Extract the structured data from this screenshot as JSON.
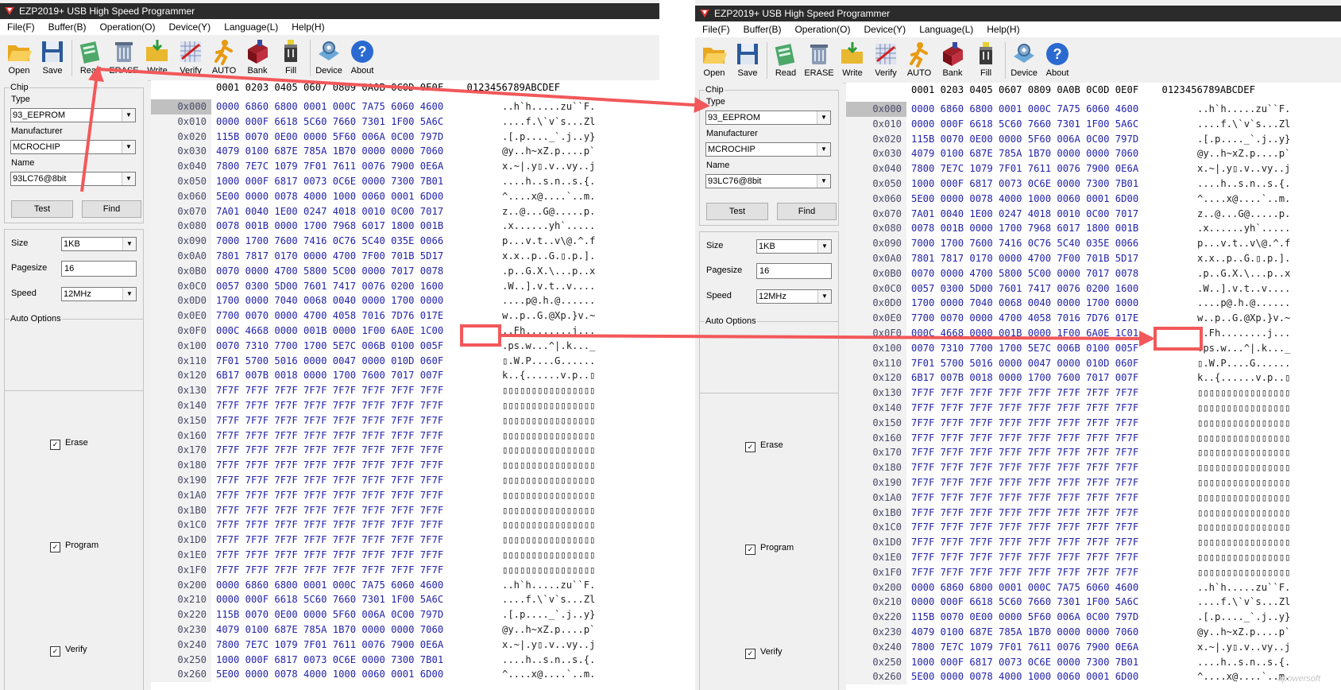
{
  "app_title": "EZP2019+ USB High Speed Programmer",
  "menu": [
    "File(F)",
    "Buffer(B)",
    "Operation(O)",
    "Device(Y)",
    "Language(L)",
    "Help(H)"
  ],
  "toolbar": {
    "open": "Open",
    "save": "Save",
    "read": "Read",
    "erase": "ERASE",
    "write": "Write",
    "verify": "Verify",
    "auto": "AUTO",
    "bank": "Bank",
    "fill": "Fill",
    "device": "Device",
    "about": "About"
  },
  "chip": {
    "group_label": "Chip",
    "type_label": "Type",
    "type_value": "93_EEPROM",
    "manufacturer_label": "Manufacturer",
    "manufacturer_value": "MCROCHIP",
    "name_label": "Name",
    "name_value": "93LC76@8bit",
    "test_button": "Test",
    "find_button": "Find"
  },
  "params": {
    "size_label": "Size",
    "size_value": "1KB",
    "pagesize_label": "Pagesize",
    "pagesize_value": "16",
    "speed_label": "Speed",
    "speed_value": "12MHz"
  },
  "auto_options": {
    "group_label": "Auto Options",
    "erase": "Erase",
    "program": "Program",
    "verify": "Verify"
  },
  "hex_header": "0001 0203 0405 0607 0809 0A0B 0C0D 0E0F    0123456789ABCDEF",
  "hex_rows": [
    [
      "0x000",
      "0000 6860 6800 0001 000C 7A75 6060 4600",
      "..h`h.....zu``F."
    ],
    [
      "0x010",
      "0000 000F 6618 5C60 7660 7301 1F00 5A6C",
      "....f.\\`v`s...Zl"
    ],
    [
      "0x020",
      "115B 0070 0E00 0000 5F60 006A 0C00 797D",
      ".[.p...._`.j..y}"
    ],
    [
      "0x030",
      "4079 0100 687E 785A 1B70 0000 0000 7060",
      "@y..h~xZ.p....p`"
    ],
    [
      "0x040",
      "7800 7E7C 1079 7F01 7611 0076 7900 0E6A",
      "x.~|.y▯.v..vy..j"
    ],
    [
      "0x050",
      "1000 000F 6817 0073 0C6E 0000 7300 7B01",
      "....h..s.n..s.{."
    ],
    [
      "0x060",
      "5E00 0000 0078 4000 1000 0060 0001 6D00",
      "^....x@....`..m."
    ],
    [
      "0x070",
      "7A01 0040 1E00 0247 4018 0010 0C00 7017",
      "z..@...G@.....p."
    ],
    [
      "0x080",
      "0078 001B 0000 1700 7968 6017 1800 001B",
      ".x......yh`....."
    ],
    [
      "0x090",
      "7000 1700 7600 7416 0C76 5C40 035E 0066",
      "p...v.t..v\\@.^.f"
    ],
    [
      "0x0A0",
      "7801 7817 0170 0000 4700 7F00 701B 5D17",
      "x.x..p..G.▯.p.]."
    ],
    [
      "0x0B0",
      "0070 0000 4700 5800 5C00 0000 7017 0078",
      ".p..G.X.\\...p..x"
    ],
    [
      "0x0C0",
      "0057 0300 5D00 7601 7417 0076 0200 1600",
      ".W..].v.t..v...."
    ],
    [
      "0x0D0",
      "1700 0000 7040 0068 0040 0000 1700 0000",
      "....p@.h.@......"
    ],
    [
      "0x0E0",
      "7700 0070 0000 4700 4058 7016 7D76 017E",
      "w..p..G.@Xp.}v.~"
    ],
    [
      "0x0F0",
      "000C 4668 0000 001B 0000 1F00 6A0E 1C00",
      "..Fh........j..."
    ],
    [
      "0x100",
      "0070 7310 7700 1700 5E7C 006B 0100 005F",
      ".ps.w...^|.k..._"
    ],
    [
      "0x110",
      "7F01 5700 5016 0000 0047 0000 010D 060F",
      "▯.W.P....G......"
    ],
    [
      "0x120",
      "6B17 007B 0018 0000 1700 7600 7017 007F",
      "k..{......v.p..▯"
    ],
    [
      "0x130",
      "7F7F 7F7F 7F7F 7F7F 7F7F 7F7F 7F7F 7F7F",
      "▯▯▯▯▯▯▯▯▯▯▯▯▯▯▯▯"
    ],
    [
      "0x140",
      "7F7F 7F7F 7F7F 7F7F 7F7F 7F7F 7F7F 7F7F",
      "▯▯▯▯▯▯▯▯▯▯▯▯▯▯▯▯"
    ],
    [
      "0x150",
      "7F7F 7F7F 7F7F 7F7F 7F7F 7F7F 7F7F 7F7F",
      "▯▯▯▯▯▯▯▯▯▯▯▯▯▯▯▯"
    ],
    [
      "0x160",
      "7F7F 7F7F 7F7F 7F7F 7F7F 7F7F 7F7F 7F7F",
      "▯▯▯▯▯▯▯▯▯▯▯▯▯▯▯▯"
    ],
    [
      "0x170",
      "7F7F 7F7F 7F7F 7F7F 7F7F 7F7F 7F7F 7F7F",
      "▯▯▯▯▯▯▯▯▯▯▯▯▯▯▯▯"
    ],
    [
      "0x180",
      "7F7F 7F7F 7F7F 7F7F 7F7F 7F7F 7F7F 7F7F",
      "▯▯▯▯▯▯▯▯▯▯▯▯▯▯▯▯"
    ],
    [
      "0x190",
      "7F7F 7F7F 7F7F 7F7F 7F7F 7F7F 7F7F 7F7F",
      "▯▯▯▯▯▯▯▯▯▯▯▯▯▯▯▯"
    ],
    [
      "0x1A0",
      "7F7F 7F7F 7F7F 7F7F 7F7F 7F7F 7F7F 7F7F",
      "▯▯▯▯▯▯▯▯▯▯▯▯▯▯▯▯"
    ],
    [
      "0x1B0",
      "7F7F 7F7F 7F7F 7F7F 7F7F 7F7F 7F7F 7F7F",
      "▯▯▯▯▯▯▯▯▯▯▯▯▯▯▯▯"
    ],
    [
      "0x1C0",
      "7F7F 7F7F 7F7F 7F7F 7F7F 7F7F 7F7F 7F7F",
      "▯▯▯▯▯▯▯▯▯▯▯▯▯▯▯▯"
    ],
    [
      "0x1D0",
      "7F7F 7F7F 7F7F 7F7F 7F7F 7F7F 7F7F 7F7F",
      "▯▯▯▯▯▯▯▯▯▯▯▯▯▯▯▯"
    ],
    [
      "0x1E0",
      "7F7F 7F7F 7F7F 7F7F 7F7F 7F7F 7F7F 7F7F",
      "▯▯▯▯▯▯▯▯▯▯▯▯▯▯▯▯"
    ],
    [
      "0x1F0",
      "7F7F 7F7F 7F7F 7F7F 7F7F 7F7F 7F7F 7F7F",
      "▯▯▯▯▯▯▯▯▯▯▯▯▯▯▯▯"
    ],
    [
      "0x200",
      "0000 6860 6800 0001 000C 7A75 6060 4600",
      "..h`h.....zu``F."
    ],
    [
      "0x210",
      "0000 000F 6618 5C60 7660 7301 1F00 5A6C",
      "....f.\\`v`s...Zl"
    ],
    [
      "0x220",
      "115B 0070 0E00 0000 5F60 006A 0C00 797D",
      ".[.p...._`.j..y}"
    ],
    [
      "0x230",
      "4079 0100 687E 785A 1B70 0000 0000 7060",
      "@y..h~xZ.p....p`"
    ],
    [
      "0x240",
      "7800 7E7C 1079 7F01 7611 0076 7900 0E6A",
      "x.~|.y▯.v..vy..j"
    ],
    [
      "0x250",
      "1000 000F 6817 0073 0C6E 0000 7300 7B01",
      "....h..s.n..s.{."
    ],
    [
      "0x260",
      "5E00 0000 0078 4000 1000 0060 0001 6D00",
      "^....x@....`..m."
    ]
  ],
  "left_window": {
    "cell_0x0F7": "1C00"
  },
  "right_window": {
    "cell_0x0F7": "1C01"
  },
  "watermark": "apowersoft",
  "colors": {
    "annotation": "#f2585a",
    "hex_words": "#2222aa",
    "titlebar": "#2b2b2b"
  }
}
